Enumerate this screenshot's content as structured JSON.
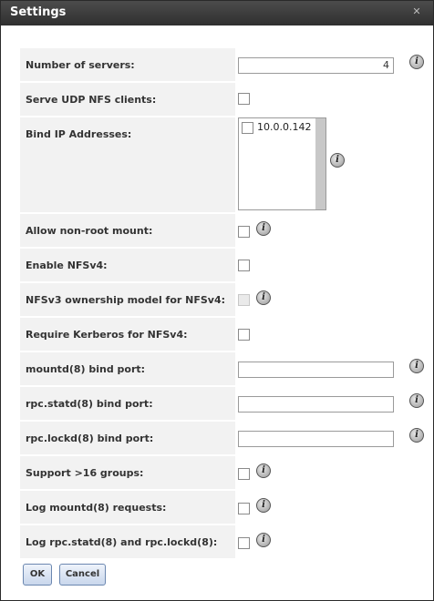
{
  "window": {
    "title": "Settings",
    "close_icon": "close-icon"
  },
  "fields": {
    "number_of_servers": {
      "label": "Number of servers:",
      "value": "4"
    },
    "serve_udp": {
      "label": "Serve UDP NFS clients:",
      "checked": false
    },
    "bind_ip": {
      "label": "Bind IP Addresses:",
      "options": [
        "10.0.0.142"
      ]
    },
    "allow_nonroot": {
      "label": "Allow non-root mount:",
      "checked": false
    },
    "enable_nfsv4": {
      "label": "Enable NFSv4:",
      "checked": false
    },
    "nfsv3_ownership": {
      "label": "NFSv3 ownership model for NFSv4:",
      "checked": false,
      "disabled": true
    },
    "require_kerberos": {
      "label": "Require Kerberos for NFSv4:",
      "checked": false
    },
    "mountd_port": {
      "label": "mountd(8) bind port:",
      "value": ""
    },
    "rpc_statd_port": {
      "label": "rpc.statd(8) bind port:",
      "value": ""
    },
    "rpc_lockd_port": {
      "label": "rpc.lockd(8) bind port:",
      "value": ""
    },
    "support_16_groups": {
      "label": "Support >16 groups:",
      "checked": false
    },
    "log_mountd": {
      "label": "Log mountd(8) requests:",
      "checked": false
    },
    "log_rpc": {
      "label": "Log rpc.statd(8) and rpc.lockd(8):",
      "checked": false
    }
  },
  "info_glyph": "i",
  "buttons": {
    "ok": "OK",
    "cancel": "Cancel"
  }
}
